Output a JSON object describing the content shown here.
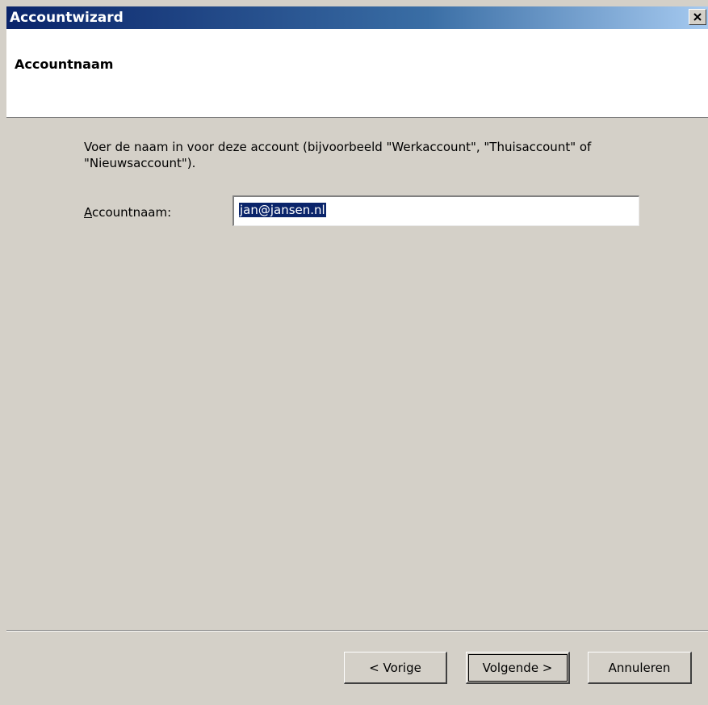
{
  "window": {
    "title": "Accountwizard"
  },
  "header": {
    "title": "Accountnaam"
  },
  "body": {
    "instruction": "Voer de naam in voor deze account (bijvoorbeeld \"Werkaccount\", \"Thuisaccount\" of \"Nieuwsaccount\").",
    "field_label_mnemonic": "A",
    "field_label_rest": "ccountnaam:",
    "field_value": "jan@jansen.nl"
  },
  "buttons": {
    "back": "< Vorige",
    "next": "Volgende >",
    "cancel": "Annuleren"
  },
  "colors": {
    "titlebar_start": "#0a246a",
    "titlebar_end": "#a6caf0",
    "dialog_bg": "#d4d0c8",
    "selection": "#0a246a"
  },
  "icons": {
    "close": "close-icon"
  }
}
